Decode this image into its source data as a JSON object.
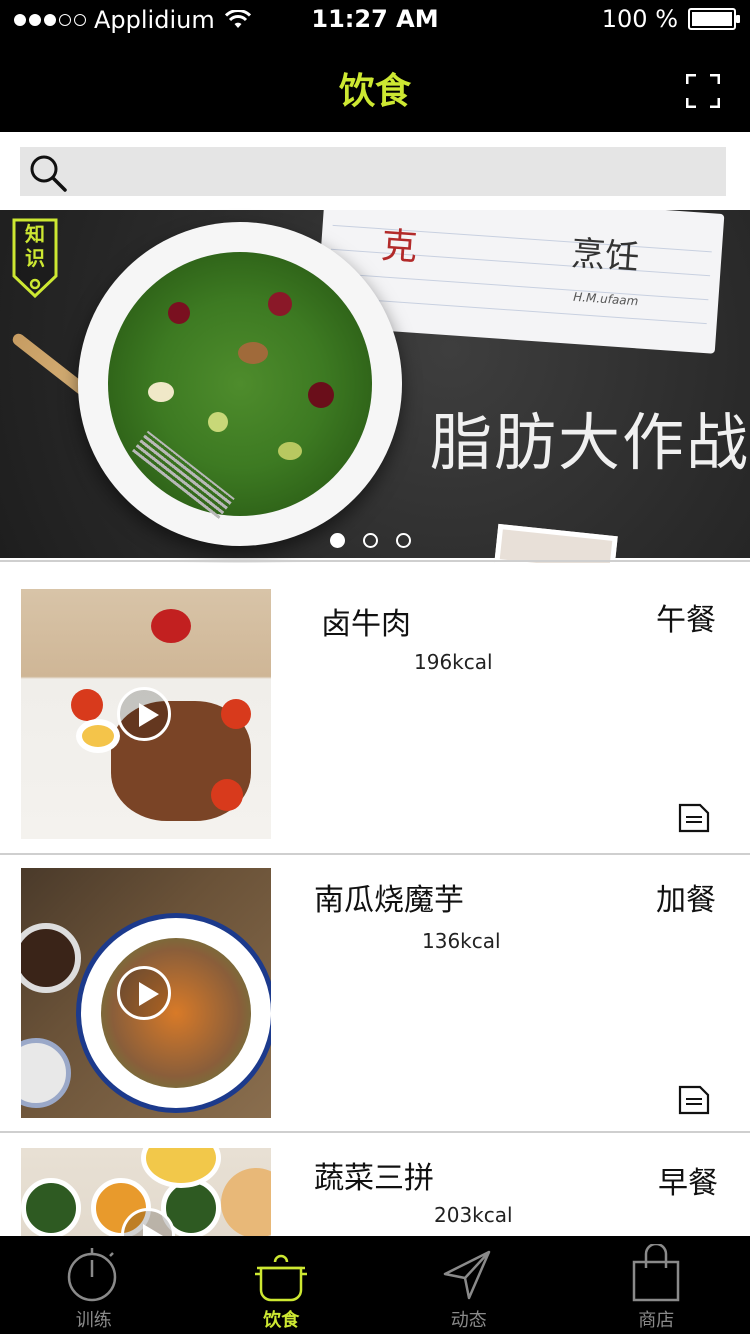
{
  "status_bar": {
    "carrier": "Applidium",
    "time": "11:27 AM",
    "battery": "100 %",
    "battery_level": 1.0
  },
  "nav": {
    "title": "饮食",
    "right_icon": "fullscreen-icon"
  },
  "search": {
    "placeholder": "",
    "icon": "search-icon"
  },
  "banner": {
    "tag_text": "知识",
    "notebook_number": "克",
    "notebook_word": "烹饪",
    "headline": "脂肪大作战",
    "pager_count": 3,
    "pager_active": 0
  },
  "meals": [
    {
      "name": "卤牛肉",
      "kcal": "196kcal",
      "type": "午餐"
    },
    {
      "name": "南瓜烧魔芋",
      "kcal": "136kcal",
      "type": "加餐"
    },
    {
      "name": "蔬菜三拼",
      "kcal": "203kcal",
      "type": "早餐"
    }
  ],
  "tabs": [
    {
      "label": "训练",
      "icon": "stopwatch-icon",
      "active": false
    },
    {
      "label": "饮食",
      "icon": "pot-icon",
      "active": true
    },
    {
      "label": "动态",
      "icon": "send-icon",
      "active": false
    },
    {
      "label": "商店",
      "icon": "shopping-bag-icon",
      "active": false
    }
  ],
  "colors": {
    "accent": "#cde832",
    "bar_background": "#000000",
    "search_background": "#e5e5e5",
    "divider": "#cfcfcf"
  }
}
